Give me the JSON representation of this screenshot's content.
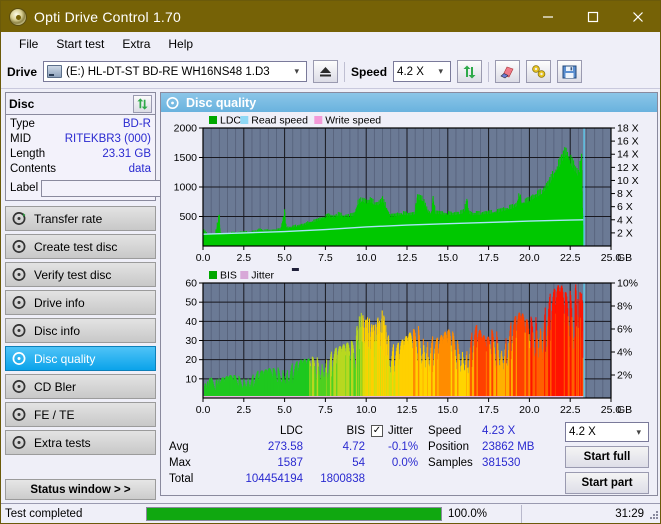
{
  "window": {
    "title": "Opti Drive Control 1.70",
    "icon": "disc-icon",
    "minimize": "—",
    "maximize": "□",
    "close": "✕",
    "titlebar_color": "#766206"
  },
  "menu": {
    "items": [
      {
        "label": "File",
        "name": "menu-file"
      },
      {
        "label": "Start test",
        "name": "menu-start-test"
      },
      {
        "label": "Extra",
        "name": "menu-extra"
      },
      {
        "label": "Help",
        "name": "menu-help"
      }
    ]
  },
  "toolbar": {
    "drive_label": "Drive",
    "drive_value": "(E:)  HL-DT-ST BD-RE  WH16NS48 1.D3",
    "eject_icon": "eject-icon",
    "speed_label": "Speed",
    "speed_value": "4.2 X",
    "refresh_icon": "refresh-icon",
    "erase_icon": "eraser-icon",
    "tools_icon": "tools-icon",
    "save_icon": "save-icon",
    "caret": "⌄"
  },
  "disc_panel": {
    "title": "Disc",
    "refresh_icon": "refresh-icon",
    "label_button_icon": "disc-icon",
    "rows": [
      {
        "key": "Type",
        "value": "BD-R"
      },
      {
        "key": "MID",
        "value": "RITEKBR3 (000)"
      },
      {
        "key": "Length",
        "value": "23.31 GB"
      },
      {
        "key": "Contents",
        "value": "data"
      }
    ],
    "label_key": "Label",
    "label_value": "",
    "label_placeholder": ""
  },
  "sidebar": {
    "items": [
      {
        "label": "Transfer rate",
        "icon": "disc-test-icon",
        "active": false
      },
      {
        "label": "Create test disc",
        "icon": "disc-write-icon",
        "active": false
      },
      {
        "label": "Verify test disc",
        "icon": "disc-verify-icon",
        "active": false
      },
      {
        "label": "Drive info",
        "icon": "drive-info-icon",
        "active": false
      },
      {
        "label": "Disc info",
        "icon": "disc-info-icon",
        "active": false
      },
      {
        "label": "Disc quality",
        "icon": "disc-quality-icon",
        "active": true
      },
      {
        "label": "CD Bler",
        "icon": "cd-bler-icon",
        "active": false
      },
      {
        "label": "FE / TE",
        "icon": "fe-te-icon",
        "active": false
      },
      {
        "label": "Extra tests",
        "icon": "extra-tests-icon",
        "active": false
      }
    ],
    "status_window": "Status window > >"
  },
  "main": {
    "header": "Disc quality",
    "header_icon": "disc-quality-icon"
  },
  "stats": {
    "col_ldc": "LDC",
    "col_bis": "BIS",
    "rows": [
      {
        "key": "Avg",
        "ldc": "273.58",
        "bis": "4.72"
      },
      {
        "key": "Max",
        "ldc": "1587",
        "bis": "54"
      },
      {
        "key": "Total",
        "ldc": "104454194",
        "bis": "1800838"
      }
    ],
    "jitter_checked": true,
    "jitter_check_glyph": "✓",
    "jitter_label": "Jitter",
    "jitter_values": [
      "-0.1%",
      "0.0%"
    ],
    "speed_key": "Speed",
    "speed_value": "4.23 X",
    "position_key": "Position",
    "position_value": "23862 MB",
    "samples_key": "Samples",
    "samples_value": "381530",
    "speed_select": "4.2 X",
    "start_full": "Start full",
    "start_part": "Start part"
  },
  "statusbar": {
    "text": "Test completed",
    "percent": "100.0%",
    "progress_value": 100,
    "time": "31:29",
    "progress_color": "#10a810"
  },
  "chart_data": [
    {
      "name": "ldc-chart",
      "type": "area",
      "title": "",
      "xlabel": "GB",
      "ylabel": "",
      "legend": [
        {
          "label": "LDC",
          "color": "#00a800"
        },
        {
          "label": "Read speed",
          "color": "#8fd8f5"
        },
        {
          "label": "Write speed",
          "color": "#f49ad8"
        }
      ],
      "legend_position": "top-left",
      "grid": true,
      "plot_bg": "#6b7a95",
      "x_ticks": [
        "0.0",
        "2.5",
        "5.0",
        "7.5",
        "10.0",
        "12.5",
        "15.0",
        "17.5",
        "20.0",
        "22.5",
        "25.0"
      ],
      "xlim": [
        0,
        25
      ],
      "y_left_ticks": [
        "500",
        "1000",
        "1500",
        "2000"
      ],
      "ylim_left": [
        0,
        2000
      ],
      "y_right_ticks": [
        "2 X",
        "4 X",
        "6 X",
        "8 X",
        "10 X",
        "12 X",
        "14 X",
        "16 X",
        "18 X"
      ],
      "ylim_right": [
        0,
        18
      ],
      "series": [
        {
          "name": "LDC",
          "color": "#00c800",
          "x": [
            0.0,
            0.25,
            0.5,
            0.75,
            1.0,
            1.05,
            1.25,
            1.5,
            1.75,
            2.0,
            2.25,
            2.5,
            2.75,
            3.0,
            3.25,
            3.5,
            3.75,
            4.0,
            4.25,
            4.5,
            4.75,
            5.0,
            5.1,
            5.25,
            5.5,
            5.75,
            6.0,
            6.25,
            6.5,
            6.75,
            7.0,
            7.25,
            7.5,
            7.75,
            8.0,
            8.25,
            8.5,
            8.75,
            9.0,
            9.25,
            9.5,
            9.75,
            10.0,
            10.25,
            10.5,
            10.75,
            11.0,
            11.25,
            11.5,
            11.75,
            12.0,
            12.25,
            12.5,
            12.75,
            13.0,
            13.1,
            13.25,
            13.5,
            13.75,
            14.0,
            14.1,
            14.25,
            14.5,
            14.75,
            15.0,
            15.25,
            15.5,
            15.75,
            16.0,
            16.2,
            16.25,
            16.5,
            16.75,
            17.0,
            17.25,
            17.5,
            17.75,
            18.0,
            18.25,
            18.5,
            18.75,
            19.0,
            19.25,
            19.4,
            19.5,
            19.75,
            20.0,
            20.25,
            20.5,
            20.75,
            21.0,
            21.25,
            21.5,
            21.75,
            22.0,
            22.25,
            22.5,
            22.75,
            23.0,
            23.2,
            23.3
          ],
          "y": [
            270,
            200,
            190,
            200,
            510,
            210,
            200,
            200,
            215,
            215,
            225,
            225,
            230,
            235,
            240,
            280,
            250,
            255,
            255,
            265,
            270,
            560,
            290,
            300,
            310,
            330,
            340,
            350,
            390,
            400,
            420,
            450,
            480,
            500,
            470,
            520,
            500,
            480,
            500,
            510,
            700,
            760,
            720,
            740,
            700,
            690,
            760,
            620,
            490,
            500,
            520,
            530,
            520,
            520,
            540,
            790,
            780,
            760,
            580,
            520,
            760,
            540,
            540,
            530,
            530,
            520,
            530,
            540,
            560,
            790,
            560,
            520,
            530,
            530,
            540,
            540,
            550,
            560,
            580,
            600,
            620,
            640,
            680,
            860,
            700,
            720,
            760,
            800,
            840,
            880,
            960,
            1050,
            1180,
            1300,
            1420,
            1560,
            1400,
            1280,
            1180,
            1400,
            100
          ]
        },
        {
          "name": "Read speed",
          "color": "#a8e4f8",
          "x": [
            0.0,
            2.5,
            5.0,
            7.5,
            10.0,
            12.5,
            15.0,
            17.5,
            20.0,
            22.5,
            23.3
          ],
          "y": [
            1.8,
            2.0,
            2.2,
            2.5,
            2.9,
            3.2,
            3.4,
            3.6,
            3.8,
            3.95,
            4.0
          ]
        }
      ],
      "end_marker": {
        "x": 23.35,
        "color": "#5fd2f5"
      }
    },
    {
      "name": "bis-jitter-chart",
      "type": "area",
      "title": "",
      "xlabel": "GB",
      "legend": [
        {
          "label": "BIS",
          "color": "#00a800"
        },
        {
          "label": "Jitter",
          "color": "#d8a8d8"
        }
      ],
      "legend_position": "top-left",
      "grid": true,
      "plot_bg": "#6b7a95",
      "x_ticks": [
        "0.0",
        "2.5",
        "5.0",
        "7.5",
        "10.0",
        "12.5",
        "15.0",
        "17.5",
        "20.0",
        "22.5",
        "25.0"
      ],
      "xlim": [
        0,
        25
      ],
      "y_left_ticks": [
        "10",
        "20",
        "30",
        "40",
        "50",
        "60"
      ],
      "ylim_left": [
        0,
        60
      ],
      "y_right_ticks": [
        "2%",
        "4%",
        "6%",
        "8%",
        "10%"
      ],
      "ylim_right": [
        0,
        10
      ],
      "series": [
        {
          "name": "BIS",
          "color_low": "#00c800",
          "color_mid": "#ffe000",
          "color_high": "#ff2000",
          "x": [
            0.1,
            0.3,
            0.5,
            0.8,
            1.0,
            1.3,
            1.6,
            1.9,
            2.2,
            2.5,
            2.8,
            3.1,
            3.4,
            3.7,
            4.0,
            4.3,
            4.6,
            4.9,
            5.2,
            5.5,
            5.8,
            6.1,
            6.4,
            6.7,
            7.0,
            7.3,
            7.6,
            7.9,
            8.2,
            8.5,
            8.8,
            9.1,
            9.4,
            9.6,
            9.8,
            10.0,
            10.2,
            10.4,
            10.6,
            10.8,
            11.0,
            11.2,
            11.4,
            11.7,
            12.0,
            12.3,
            12.6,
            12.9,
            13.2,
            13.5,
            13.8,
            14.1,
            14.4,
            14.7,
            15.0,
            15.3,
            15.6,
            15.9,
            16.2,
            16.5,
            16.8,
            17.1,
            17.4,
            17.7,
            18.0,
            18.3,
            18.6,
            18.9,
            19.2,
            19.5,
            19.8,
            20.1,
            20.4,
            20.7,
            21.0,
            21.3,
            21.6,
            21.9,
            22.2,
            22.5,
            22.8,
            23.0,
            23.2,
            23.3
          ],
          "y": [
            6,
            8,
            9,
            8,
            9,
            9,
            10,
            10,
            10,
            10,
            11,
            11,
            12,
            12,
            13,
            13,
            14,
            15,
            15,
            16,
            16,
            17,
            17,
            18,
            19,
            19,
            20,
            21,
            22,
            23,
            24,
            25,
            30,
            38,
            36,
            34,
            37,
            30,
            38,
            33,
            39,
            32,
            26,
            25,
            24,
            26,
            28,
            30,
            33,
            32,
            30,
            28,
            26,
            28,
            30,
            29,
            27,
            26,
            24,
            30,
            32,
            28,
            26,
            30,
            32,
            28,
            30,
            34,
            36,
            38,
            34,
            36,
            40,
            42,
            44,
            46,
            48,
            50,
            46,
            48,
            50,
            47,
            46,
            40
          ]
        }
      ],
      "end_marker": {
        "x": 23.35,
        "color": "#5fd2f5"
      }
    }
  ]
}
